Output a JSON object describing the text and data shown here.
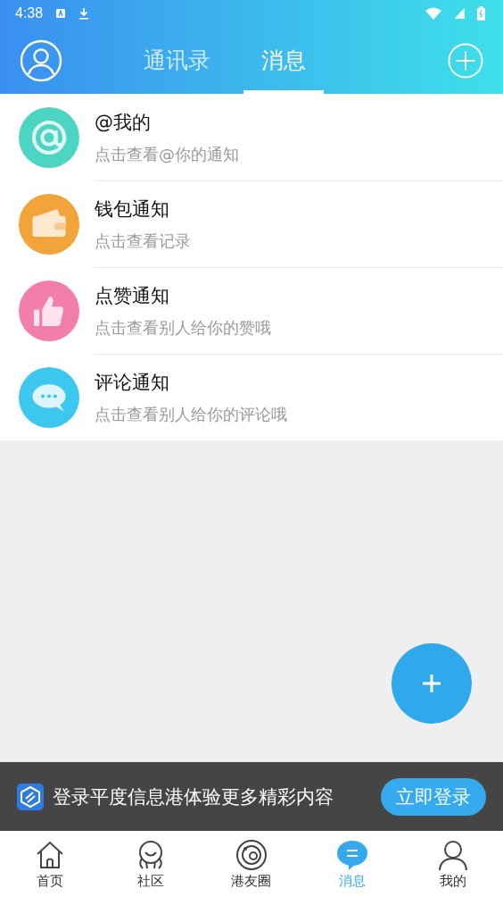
{
  "status_bar": {
    "time": "4:38"
  },
  "header": {
    "tabs": [
      {
        "label": "通讯录",
        "selected": false
      },
      {
        "label": "消息",
        "selected": true
      }
    ]
  },
  "notifications": [
    {
      "kind": "at",
      "color": "#4dd5c4",
      "title": "@我的",
      "subtitle": "点击查看@你的通知"
    },
    {
      "kind": "wallet",
      "color": "#f2a43a",
      "title": "钱包通知",
      "subtitle": "点击查看记录"
    },
    {
      "kind": "like",
      "color": "#f27fa9",
      "title": "点赞通知",
      "subtitle": "点击查看别人给你的赞哦"
    },
    {
      "kind": "comment",
      "color": "#3cc8ee",
      "title": "评论通知",
      "subtitle": "点击查看别人给你的评论哦"
    }
  ],
  "login_banner": {
    "text": "登录平度信息港体验更多精彩内容",
    "button": "立即登录"
  },
  "bottom_nav": [
    {
      "kind": "home",
      "label": "首页",
      "selected": false
    },
    {
      "kind": "community",
      "label": "社区",
      "selected": false
    },
    {
      "kind": "circle",
      "label": "港友圈",
      "selected": false
    },
    {
      "kind": "message",
      "label": "消息",
      "selected": true
    },
    {
      "kind": "me",
      "label": "我的",
      "selected": false
    }
  ]
}
